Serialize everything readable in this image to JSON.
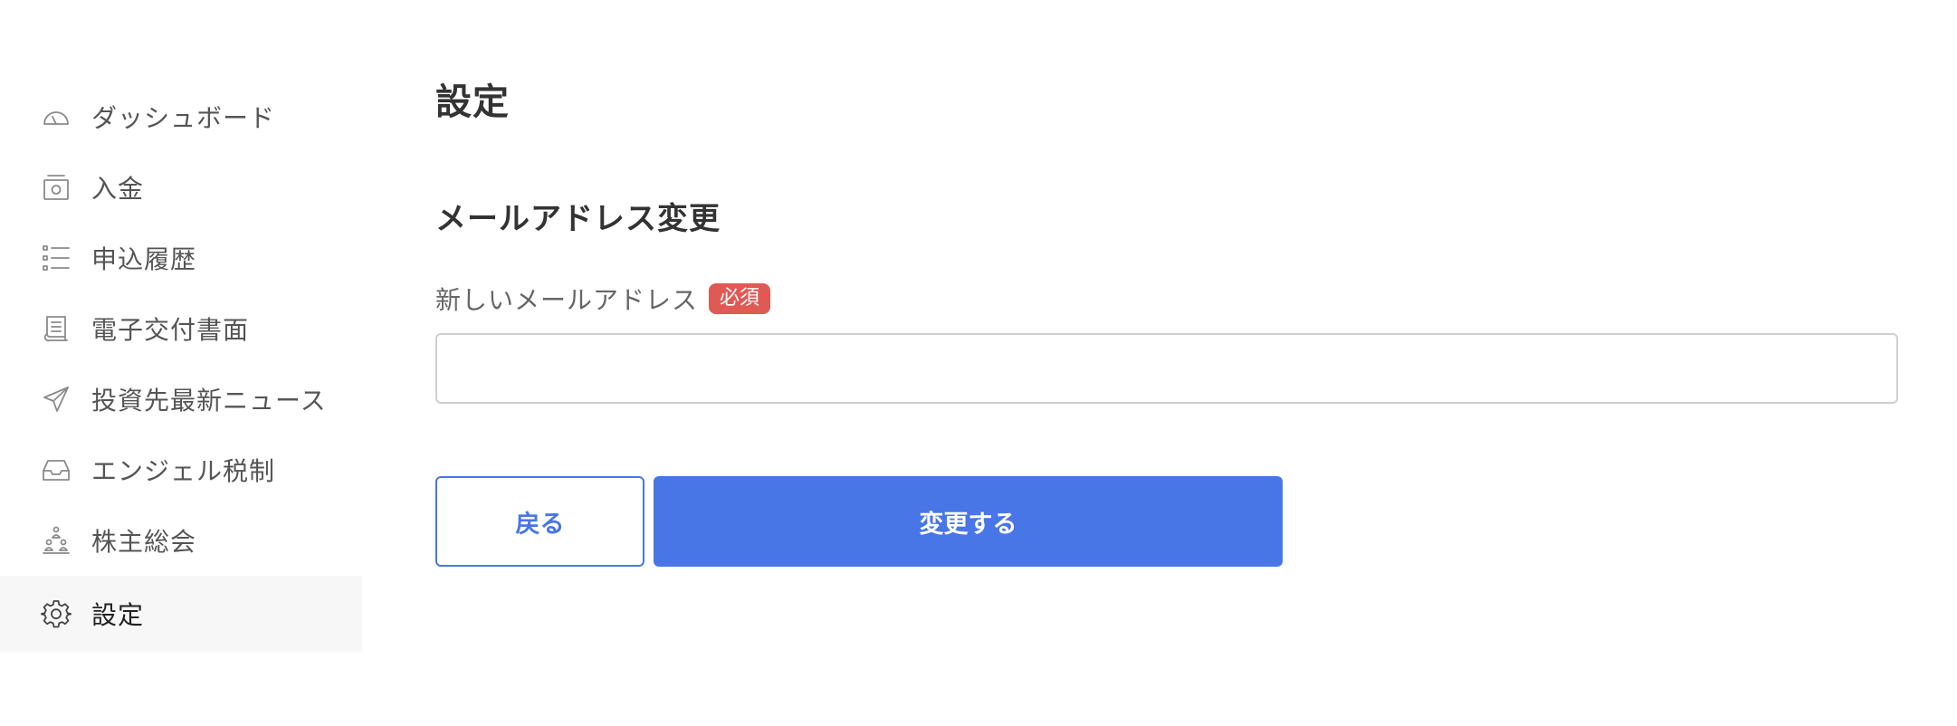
{
  "sidebar": {
    "items": [
      {
        "label": "ダッシュボード",
        "icon": "dashboard-gauge-icon"
      },
      {
        "label": "入金",
        "icon": "deposit-safe-icon"
      },
      {
        "label": "申込履歴",
        "icon": "list-icon"
      },
      {
        "label": "電子交付書面",
        "icon": "document-icon"
      },
      {
        "label": "投資先最新ニュース",
        "icon": "paper-plane-icon"
      },
      {
        "label": "エンジェル税制",
        "icon": "inbox-tray-icon"
      },
      {
        "label": "株主総会",
        "icon": "people-group-icon"
      },
      {
        "label": "設定",
        "icon": "gear-icon",
        "active": true
      }
    ]
  },
  "main": {
    "page_title": "設定",
    "section_title": "メールアドレス変更",
    "field": {
      "label": "新しいメールアドレス",
      "required_badge": "必須",
      "value": "",
      "placeholder": ""
    },
    "buttons": {
      "back": "戻る",
      "submit": "変更する"
    }
  },
  "colors": {
    "accent": "#4876e6",
    "required": "#e05a55",
    "active_bg": "#f7f7f7"
  }
}
